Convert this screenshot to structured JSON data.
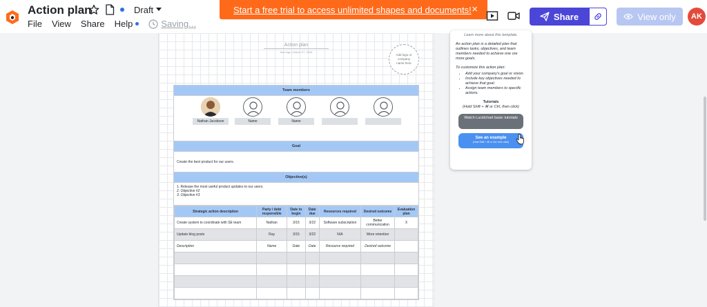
{
  "app": {
    "title": "Action plan",
    "status": "Draft",
    "saving": "Saving...",
    "menu": [
      "File",
      "View",
      "Share",
      "Help"
    ]
  },
  "banner": {
    "text": "Start a free trial to access unlimited shapes and documents!",
    "close": "×"
  },
  "toolbar": {
    "share_label": "Share",
    "view_only_label": "View only",
    "avatar_initials": "AK"
  },
  "colors": {
    "accent": "#4b45d8",
    "banner": "#ff6a1a",
    "avatar": "#e24b3b",
    "section_header": "#a4c8f6"
  },
  "document": {
    "title": "Action plan",
    "subtitle": "Add logo | March 07, 2026",
    "logo_placeholder": "Add logo or company name here",
    "team_header": "Team members",
    "members": [
      "Nathan Jacobson",
      "Name",
      "Name",
      "",
      ""
    ],
    "goal_header": "Goal",
    "goal_text": "Create the best product for our users.",
    "objectives_header": "Objective(s)",
    "objectives": [
      "1.  Release the most useful product updates to our users.",
      "2.  Objective #2",
      "3.  Objective #3"
    ],
    "table": {
      "headers": [
        "Strategic action description",
        "Party / debt responsible",
        "Date to begin",
        "Date due",
        "Resources required",
        "Desired outcome",
        "Evaluation plan"
      ],
      "rows": [
        [
          "Create system to coordinate with SE team",
          "Nathan",
          "3/15",
          "3/22",
          "Software subscription",
          "Better communication",
          "X"
        ],
        [
          "Update blog posts",
          "Ray",
          "3/15",
          "3/22",
          "N/A",
          "More retention",
          ""
        ],
        [
          "Description",
          "Name",
          "Date",
          "Date",
          "Resource required",
          "Desired outcome",
          ""
        ],
        [
          "",
          "",
          "",
          "",
          "",
          "",
          ""
        ],
        [
          "",
          "",
          "",
          "",
          "",
          "",
          ""
        ],
        [
          "",
          "",
          "",
          "",
          "",
          "",
          ""
        ],
        [
          "",
          "",
          "",
          "",
          "",
          "",
          ""
        ]
      ]
    }
  },
  "panel": {
    "top": "Learn more about this template.",
    "intro": "An action plan is a detailed plan that outlines tasks, objectives, and team members needed to achieve one ore more goals.",
    "customize": "To customize this action plan:",
    "steps": [
      "Add your company's goal or vision.",
      "Include key objectives needed to achieve that goal.",
      "Assign team members to specific actions."
    ],
    "tutorials_title": "Tutorials",
    "tutorials_sub": "(Hold Shift + ⌘ or Ctrl, then click)",
    "watch_button": "Watch Lucidchart basic tutorials",
    "see_button": "See an example",
    "see_button_sub": "(Hold Shift + ⌘ or Ctrl, then click)"
  }
}
